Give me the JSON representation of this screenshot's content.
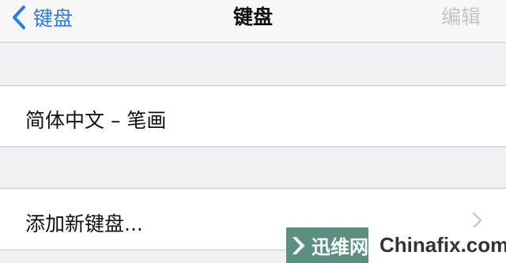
{
  "navbar": {
    "back_label": "键盘",
    "title": "键盘",
    "edit_label": "编辑"
  },
  "rows": [
    {
      "label": "简体中文 – 笔画"
    },
    {
      "label": "添加新键盘..."
    }
  ],
  "watermark": {
    "brand": "迅维网",
    "site": "Chinafix.com"
  },
  "colors": {
    "accent": "#2a7de1",
    "disabled": "#c4c4c8",
    "group_background": "#efeff4",
    "watermark_green": "#5a8f82"
  },
  "icons": {
    "back": "chevron-left-icon",
    "disclosure": "chevron-right-icon",
    "watermark_logo": "arrow-logo-icon"
  }
}
